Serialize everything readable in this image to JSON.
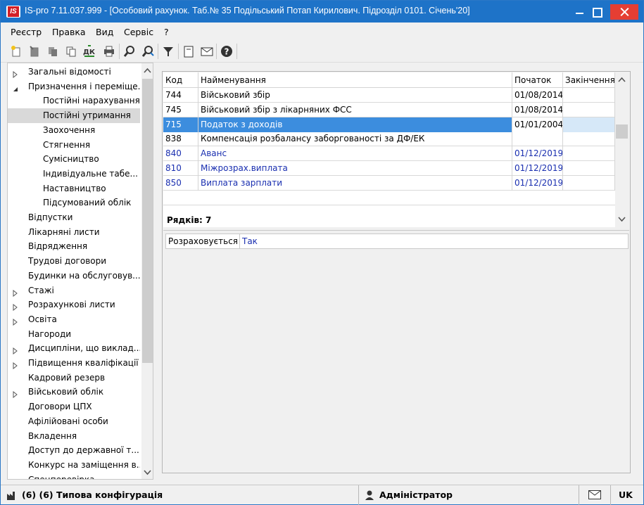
{
  "window": {
    "title": "IS-pro 7.11.037.999 - [Особовий рахунок. Таб.№ 35 Подільський Потап Кирилович. Підрозділ 0101. Січень'20]",
    "logo": "IS"
  },
  "menu": [
    "Реєстр",
    "Правка",
    "Вид",
    "Сервіс",
    "?"
  ],
  "toolbar": [
    "new-icon",
    "edit-icon",
    "delete-icon",
    "copy-icon",
    "debit-credit-icon",
    "print-icon",
    "find-icon",
    "find-next-icon",
    "filter-icon",
    "form-icon",
    "mail-icon",
    "help-icon"
  ],
  "tree": [
    {
      "label": "Загальні відомості",
      "level": 0,
      "arrow": "right"
    },
    {
      "label": "Призначення і переміще...",
      "level": 0,
      "arrow": "down"
    },
    {
      "label": "Постійні нарахування",
      "level": 1
    },
    {
      "label": "Постійні утримання",
      "level": 1,
      "selected": true
    },
    {
      "label": "Заохочення",
      "level": 1
    },
    {
      "label": "Стягнення",
      "level": 1
    },
    {
      "label": "Сумісництво",
      "level": 1
    },
    {
      "label": "Індивідуальне табе...",
      "level": 1
    },
    {
      "label": "Наставництво",
      "level": 1
    },
    {
      "label": "Підсумований облік",
      "level": 1
    },
    {
      "label": "Відпустки",
      "level": 0
    },
    {
      "label": "Лікарняні листи",
      "level": 0
    },
    {
      "label": "Відрядження",
      "level": 0
    },
    {
      "label": "Трудові договори",
      "level": 0
    },
    {
      "label": "Будинки на обслуговув...",
      "level": 0
    },
    {
      "label": "Стажі",
      "level": 0,
      "arrow": "right"
    },
    {
      "label": "Розрахункові листи",
      "level": 0,
      "arrow": "right"
    },
    {
      "label": "Освіта",
      "level": 0,
      "arrow": "right"
    },
    {
      "label": "Нагороди",
      "level": 0
    },
    {
      "label": "Дисципліни, що виклад...",
      "level": 0,
      "arrow": "right"
    },
    {
      "label": "Підвищення кваліфікації",
      "level": 0,
      "arrow": "right"
    },
    {
      "label": "Кадровий резерв",
      "level": 0
    },
    {
      "label": "Військовий облік",
      "level": 0,
      "arrow": "right"
    },
    {
      "label": "Договори ЦПХ",
      "level": 0
    },
    {
      "label": "Афілійовані особи",
      "level": 0
    },
    {
      "label": "Вкладення",
      "level": 0
    },
    {
      "label": "Доступ до державної т...",
      "level": 0
    },
    {
      "label": "Конкурс на заміщення в...",
      "level": 0
    },
    {
      "label": "Спецперевірка",
      "level": 0
    }
  ],
  "grid": {
    "columns": [
      "Код",
      "Найменування",
      "Початок",
      "Закінчення"
    ],
    "rows": [
      {
        "code": "744",
        "name": "Військовий збір",
        "start": "01/08/2014",
        "end": "",
        "style": "normal"
      },
      {
        "code": "745",
        "name": "Військовий збір з лікарняних ФСС",
        "start": "01/08/2014",
        "end": "",
        "style": "normal"
      },
      {
        "code": "715",
        "name": "Податок з доходів",
        "start": "01/01/2004",
        "end": "",
        "style": "selected"
      },
      {
        "code": "838",
        "name": "Компенсація розбалансу заборгованості за ДФ/ЕК",
        "start": "",
        "end": "",
        "style": "normal"
      },
      {
        "code": "840",
        "name": "Аванс",
        "start": "01/12/2019",
        "end": "",
        "style": "blue"
      },
      {
        "code": "810",
        "name": "Міжрозрах.виплата",
        "start": "01/12/2019",
        "end": "",
        "style": "blue"
      },
      {
        "code": "850",
        "name": "Виплата зарплати",
        "start": "01/12/2019",
        "end": "",
        "style": "blue"
      }
    ],
    "rows_count": "Рядків: 7"
  },
  "detail": {
    "label": "Розраховується",
    "value": "Так"
  },
  "status": {
    "config": "(6) (6) Типова конфігурація",
    "user": "Адміністратор",
    "lang": "UK"
  }
}
